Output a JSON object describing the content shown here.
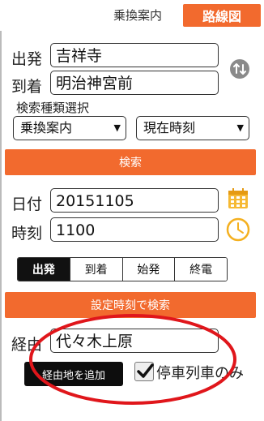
{
  "header": {
    "tab_transfer": "乗換案内",
    "tab_route": "路線図"
  },
  "form": {
    "from_label": "出発",
    "from_value": "吉祥寺",
    "to_label": "到着",
    "to_value": "明治神宮前",
    "search_type_label": "検索種類選択",
    "search_type_selected": "乗換案内",
    "time_type_selected": "現在時刻",
    "search_button": "検索",
    "date_label": "日付",
    "date_value": "20151105",
    "time_label": "時刻",
    "time_value": "1100",
    "time_modes": [
      "出発",
      "到着",
      "始発",
      "終電"
    ],
    "time_mode_active": "出発",
    "search_with_time_button": "設定時刻で検索",
    "via_label": "経由",
    "via_value": "代々木上原",
    "add_via_button": "経由地を追加",
    "stop_only_label": "停車列車のみ",
    "stop_only_checked": true
  },
  "colors": {
    "accent": "#f26a2e",
    "highlight_circle": "#e0161b"
  },
  "icons": [
    "swap-icon",
    "calendar-icon",
    "clock-icon",
    "checkmark-icon"
  ]
}
